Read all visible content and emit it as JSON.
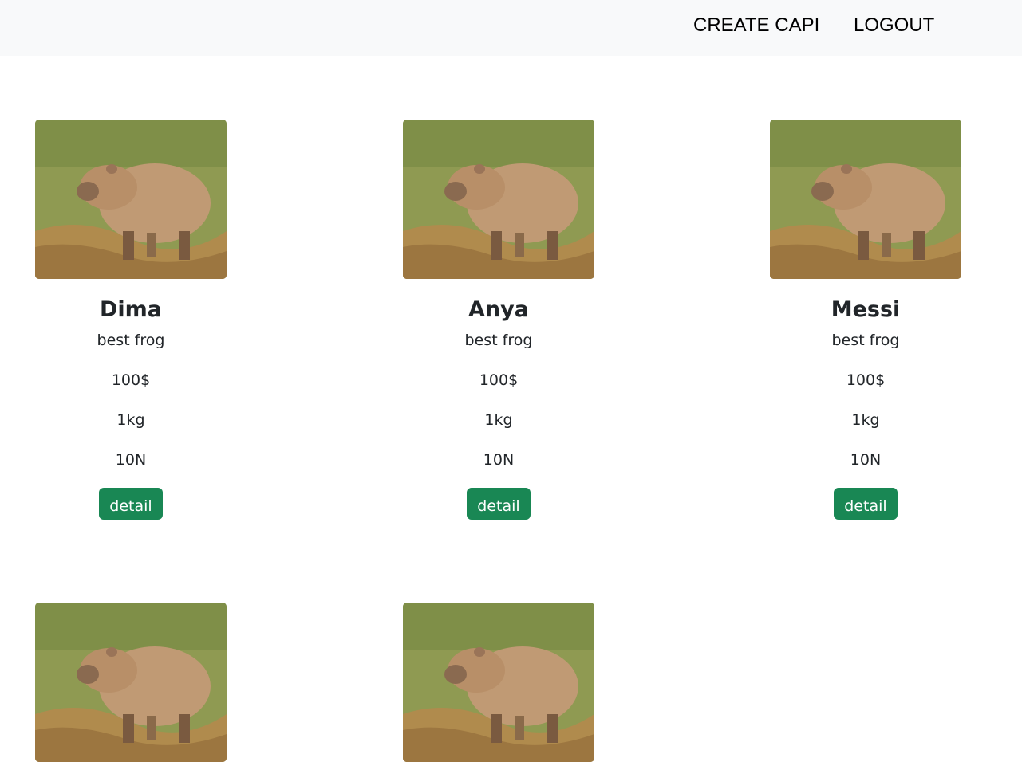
{
  "nav": {
    "create_label": "CREATE CAPI",
    "logout_label": "LOGOUT"
  },
  "cards": [
    {
      "name": "Dima",
      "description": "best frog",
      "price": "100$",
      "weight": "1kg",
      "power": "10N",
      "button_label": "detail"
    },
    {
      "name": "Anya",
      "description": "best frog",
      "price": "100$",
      "weight": "1kg",
      "power": "10N",
      "button_label": "detail"
    },
    {
      "name": "Messi",
      "description": "best frog",
      "price": "100$",
      "weight": "1kg",
      "power": "10N",
      "button_label": "detail"
    },
    {
      "name": "",
      "description": "",
      "price": "",
      "weight": "",
      "power": "",
      "button_label": ""
    },
    {
      "name": "",
      "description": "",
      "price": "",
      "weight": "",
      "power": "",
      "button_label": ""
    }
  ],
  "colors": {
    "navbar_bg": "#f8f9fa",
    "button_bg": "#198754",
    "button_text": "#ffffff"
  },
  "image": {
    "subject": "capybara-photo"
  }
}
